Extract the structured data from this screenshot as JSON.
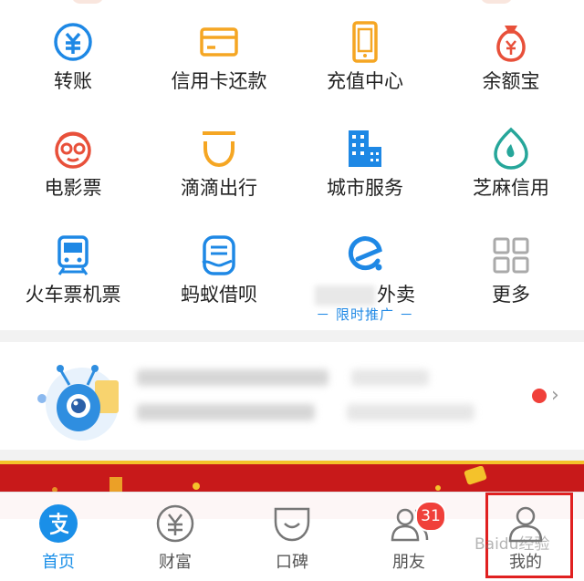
{
  "grid": {
    "items": [
      {
        "label": "转账",
        "icon": "transfer-icon",
        "color": "#1e88e5"
      },
      {
        "label": "信用卡还款",
        "icon": "credit-card-icon",
        "color": "#f5a623"
      },
      {
        "label": "充值中心",
        "icon": "phone-recharge-icon",
        "color": "#f5a623"
      },
      {
        "label": "余额宝",
        "icon": "money-bag-icon",
        "color": "#e8503a"
      },
      {
        "label": "电影票",
        "icon": "movie-ticket-icon",
        "color": "#e8503a"
      },
      {
        "label": "滴滴出行",
        "icon": "didi-icon",
        "color": "#f5a623"
      },
      {
        "label": "城市服务",
        "icon": "city-building-icon",
        "color": "#1e88e5"
      },
      {
        "label": "芝麻信用",
        "icon": "sesame-credit-icon",
        "color": "#26a69a"
      },
      {
        "label": "火车票机票",
        "icon": "train-icon",
        "color": "#1e88e5"
      },
      {
        "label": "蚂蚁借呗",
        "icon": "ant-loan-icon",
        "color": "#1e88e5"
      },
      {
        "label": "外卖",
        "icon": "eleme-icon",
        "color": "#1e88e5",
        "promo": "－ 限时推广 －"
      },
      {
        "label": "更多",
        "icon": "more-grid-icon",
        "color": "#aaaaaa"
      }
    ]
  },
  "tabbar": {
    "tabs": [
      {
        "label": "首页",
        "icon": "home-alipay-icon",
        "active": true
      },
      {
        "label": "财富",
        "icon": "wealth-yen-icon"
      },
      {
        "label": "口碑",
        "icon": "koubei-icon"
      },
      {
        "label": "朋友",
        "icon": "friends-icon",
        "badge": "31"
      },
      {
        "label": "我的",
        "icon": "profile-icon"
      }
    ]
  },
  "watermark": "Baidu经验",
  "colors": {
    "accent": "#1e88e5",
    "badge": "#f0403a",
    "banner": "#c8191a",
    "highlight": "#e02020"
  }
}
